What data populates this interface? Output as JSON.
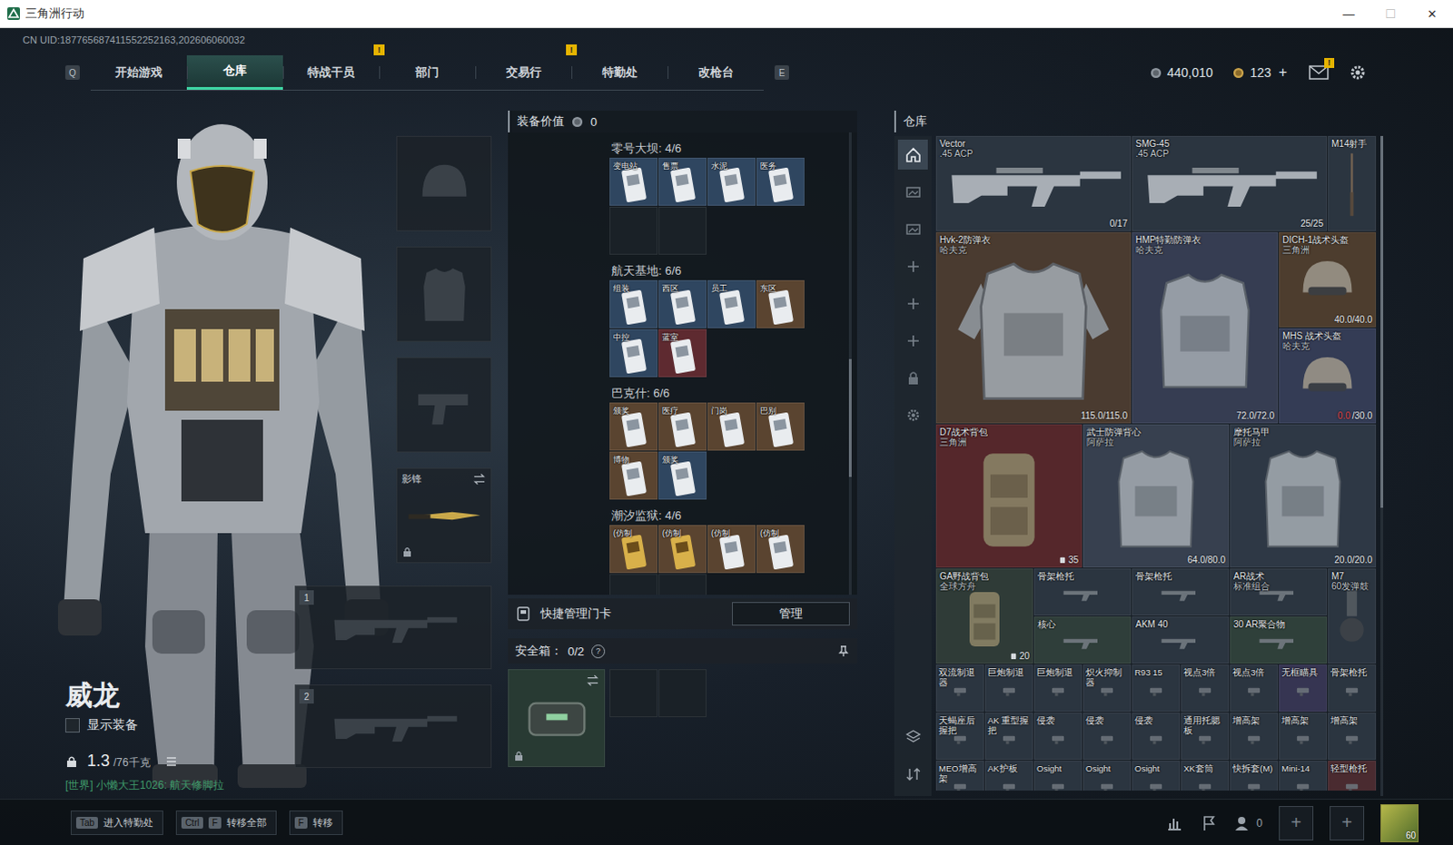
{
  "window": {
    "title": "三角洲行动",
    "controls": [
      {
        "glyph": "—",
        "disabled": false
      },
      {
        "glyph": "☐",
        "disabled": true
      },
      {
        "glyph": "✕",
        "disabled": false
      }
    ]
  },
  "uid": "CN UID:187765687411552252163,202606060032",
  "nav": {
    "prev_key": "Q",
    "next_key": "E",
    "tabs": [
      {
        "label": "开始游戏",
        "selected": false,
        "badge": ""
      },
      {
        "label": "仓库",
        "selected": true,
        "badge": ""
      },
      {
        "label": "特战干员",
        "selected": false,
        "badge": ""
      },
      {
        "label": "部门",
        "selected": false,
        "badge": "!"
      },
      {
        "label": "交易行",
        "selected": false,
        "badge": ""
      },
      {
        "label": "特勤处",
        "selected": false,
        "badge": "!"
      },
      {
        "label": "改枪台",
        "selected": false,
        "badge": ""
      }
    ]
  },
  "wallet": {
    "coins": "440,010",
    "bonds": "123",
    "bonds_add": "+",
    "mail_badge": "!"
  },
  "operator": {
    "name": "威龙",
    "show_gear": {
      "label": "显示装备",
      "checked": false
    },
    "weight": "1.3",
    "weight_max": "/76千克",
    "chat": "[世界] 小懒大王1026: 航天修脚拉"
  },
  "loadout": {
    "empty_slots": [
      "helmet",
      "armor",
      "pistol"
    ],
    "melee": {
      "label": "影锋",
      "locked": true
    },
    "weapon_slots": [
      "1",
      "2"
    ]
  },
  "equipment_value": {
    "label": "装备价值",
    "value": "0"
  },
  "keycards": [
    {
      "name": "零号大坝: 4/6",
      "slots": 6,
      "cards": [
        {
          "label": "变电站",
          "color": "#2f4660",
          "gold": false
        },
        {
          "label": "售票",
          "color": "#2f4660",
          "gold": false
        },
        {
          "label": "水泥",
          "color": "#2f4660",
          "gold": false
        },
        {
          "label": "医务",
          "color": "#2f4660",
          "gold": false
        }
      ]
    },
    {
      "name": "航天基地: 6/6",
      "slots": 6,
      "cards": [
        {
          "label": "组装",
          "color": "#2f4660",
          "gold": false
        },
        {
          "label": "西区",
          "color": "#2f4660",
          "gold": false
        },
        {
          "label": "员工",
          "color": "#2f4660",
          "gold": false
        },
        {
          "label": "东区",
          "color": "#5a4430",
          "gold": false
        },
        {
          "label": "中控",
          "color": "#2f4660",
          "gold": false
        },
        {
          "label": "蓝室",
          "color": "#5e2a30",
          "gold": false
        }
      ]
    },
    {
      "name": "巴克什: 6/6",
      "slots": 6,
      "cards": [
        {
          "label": "颁奖",
          "color": "#5a4430",
          "gold": false
        },
        {
          "label": "医疗",
          "color": "#5a4430",
          "gold": false
        },
        {
          "label": "门岗",
          "color": "#5a4430",
          "gold": false
        },
        {
          "label": "巴别",
          "color": "#5a4430",
          "gold": false
        },
        {
          "label": "博物",
          "color": "#5a4430",
          "gold": false
        },
        {
          "label": "颁奖",
          "color": "#2f4660",
          "gold": false
        }
      ]
    },
    {
      "name": "潮汐监狱: 4/6",
      "slots": 6,
      "cards": [
        {
          "label": "(仿制",
          "color": "#5a4430",
          "gold": true
        },
        {
          "label": "(仿制",
          "color": "#5a4430",
          "gold": true
        },
        {
          "label": "(仿制",
          "color": "#5a4430",
          "gold": false
        },
        {
          "label": "(仿制",
          "color": "#5a4430",
          "gold": false
        }
      ]
    }
  ],
  "manage": {
    "label": "快捷管理门卡",
    "button": "管理"
  },
  "safebox": {
    "label": "安全箱：",
    "count": "0/2",
    "help": "?",
    "slots": 2,
    "locked": true
  },
  "warehouse": {
    "title": "仓库",
    "sidebar_top": [
      {
        "kind": "home",
        "selected": true
      },
      {
        "kind": "gallery",
        "selected": false
      },
      {
        "kind": "gallery",
        "selected": false
      },
      {
        "kind": "add",
        "selected": false
      },
      {
        "kind": "add",
        "selected": false
      },
      {
        "kind": "add",
        "selected": false
      },
      {
        "kind": "lock",
        "selected": false
      },
      {
        "kind": "settings",
        "selected": false
      }
    ],
    "sidebar_bottom": [
      {
        "kind": "layers",
        "selected": false
      },
      {
        "kind": "sort",
        "selected": false
      }
    ],
    "items": [
      {
        "name": "Vector",
        "sub": ".45 ACP",
        "value": "0/17",
        "kind": "rifle",
        "color": "#2b3540"
      },
      {
        "name": "SMG-45",
        "sub": ".45 ACP",
        "value": "25/25",
        "kind": "rifle",
        "color": "#2b3540"
      },
      {
        "name": "M14射手",
        "sub": "",
        "value": "",
        "kind": "marksman",
        "color": "#2b3540"
      },
      {
        "name": "Hvk-2防弹衣",
        "sub": "哈夫克",
        "value": "115.0/115.0",
        "kind": "armor-large",
        "color": "#4a3b30"
      },
      {
        "name": "HMP特勤防弹衣",
        "sub": "哈夫克",
        "value": "72.0/72.0",
        "kind": "armor",
        "color": "#363d52"
      },
      {
        "name": "DICH-1战术头盔",
        "sub": "三角洲",
        "value": "40.0/40.0",
        "kind": "helmet",
        "color": "#4d3d2e"
      },
      {
        "name": "MHS 战术头盔",
        "sub": "哈夫克",
        "value": "0.0",
        "value_max": "/30.0",
        "low": true,
        "kind": "helmet",
        "color": "#343c55"
      },
      {
        "name": "D7战术背包",
        "sub": "三角洲",
        "count": "35",
        "kind": "bag",
        "color": "#55272b"
      },
      {
        "name": "武士防弹背心",
        "sub": "阿萨拉",
        "value": "64.0/80.0",
        "kind": "vest",
        "color": "#37404f"
      },
      {
        "name": "摩托马甲",
        "sub": "阿萨拉",
        "value": "20.0/20.0",
        "kind": "vest",
        "color": "#2e3845"
      },
      {
        "name": "GA野战背包",
        "sub": "全球方舟",
        "count": "20",
        "kind": "bag-small",
        "color": "#2f3b37"
      },
      {
        "name": "骨架枪托",
        "sub": "",
        "kind": "part-wide",
        "color": "#2b3540"
      },
      {
        "name": "骨架枪托",
        "sub": "",
        "kind": "part-wide",
        "color": "#2b3540"
      },
      {
        "name": "AR战术",
        "sub": "标准组合",
        "kind": "part-wide",
        "color": "#2b3540"
      },
      {
        "name": "M7",
        "sub": "60发弹鼓",
        "kind": "mag-tall",
        "color": "#2b3540"
      },
      {
        "name": "核心",
        "sub": "",
        "kind": "part-wide",
        "color": "#2f3e3a"
      },
      {
        "name": "AKM 40",
        "sub": "",
        "kind": "part-wide",
        "color": "#2b3540"
      },
      {
        "name": "30 AR聚合物",
        "sub": "",
        "kind": "part-wide",
        "color": "#2f403a"
      },
      {
        "name": "双流制退器",
        "sub": "",
        "kind": "part",
        "color": "#2b3540"
      },
      {
        "name": "巨炮制退",
        "sub": "",
        "kind": "part",
        "color": "#2b3540"
      },
      {
        "name": "巨炮制退",
        "sub": "",
        "kind": "part",
        "color": "#2b3540"
      },
      {
        "name": "炽火抑制器",
        "sub": "",
        "kind": "part",
        "color": "#2b3540"
      },
      {
        "name": "R93 15",
        "sub": "",
        "kind": "part",
        "color": "#2b3540"
      },
      {
        "name": "视点3倍",
        "sub": "",
        "kind": "part",
        "color": "#2b3540"
      },
      {
        "name": "视点3倍",
        "sub": "",
        "kind": "part",
        "color": "#2b3540"
      },
      {
        "name": "无框瞄具",
        "sub": "",
        "kind": "part",
        "color": "#363552"
      },
      {
        "name": "骨架枪托",
        "sub": "",
        "kind": "part",
        "color": "#2b3540"
      },
      {
        "name": "天蝎座后握把",
        "sub": "",
        "kind": "part",
        "color": "#2b3540"
      },
      {
        "name": "AK 重型握把",
        "sub": "",
        "kind": "part",
        "color": "#2b3540"
      },
      {
        "name": "侵袭",
        "sub": "",
        "kind": "part",
        "color": "#2b3540"
      },
      {
        "name": "侵袭",
        "sub": "",
        "kind": "part",
        "color": "#2b3540"
      },
      {
        "name": "侵袭",
        "sub": "",
        "kind": "part",
        "color": "#2b3540"
      },
      {
        "name": "通用托腮板",
        "sub": "",
        "kind": "part",
        "color": "#2b3540"
      },
      {
        "name": "增高架",
        "sub": "",
        "kind": "part",
        "color": "#2b3540"
      },
      {
        "name": "增高架",
        "sub": "",
        "kind": "part",
        "color": "#2b3540"
      },
      {
        "name": "增高架",
        "sub": "",
        "kind": "part",
        "color": "#2b3540"
      },
      {
        "name": "MEO增高架",
        "sub": "",
        "kind": "part",
        "color": "#2b3540"
      },
      {
        "name": "AK护板",
        "sub": "",
        "kind": "part",
        "color": "#2b3540"
      },
      {
        "name": "Osight",
        "sub": "",
        "kind": "part",
        "color": "#2b3540"
      },
      {
        "name": "Osight",
        "sub": "",
        "kind": "part",
        "color": "#2b3540"
      },
      {
        "name": "Osight",
        "sub": "",
        "kind": "part",
        "color": "#2b3540"
      },
      {
        "name": "XK套筒",
        "sub": "",
        "kind": "part",
        "color": "#2b3540"
      },
      {
        "name": "快拆套(M)",
        "sub": "",
        "kind": "part",
        "color": "#2b3540"
      },
      {
        "name": "Mini-14",
        "sub": "",
        "kind": "part",
        "color": "#2b3540"
      },
      {
        "name": "轻型枪托",
        "sub": "",
        "kind": "part",
        "color": "#4a2b30"
      }
    ]
  },
  "bottom": {
    "hints": [
      {
        "keys": [
          "Tab"
        ],
        "label": "进入特勤处"
      },
      {
        "keys": [
          "Ctrl",
          "F"
        ],
        "label": "转移全部"
      },
      {
        "keys": [
          "F"
        ],
        "label": "转移"
      }
    ],
    "friends": "0",
    "invite_slots": [
      "+",
      "+"
    ],
    "level": "60"
  }
}
